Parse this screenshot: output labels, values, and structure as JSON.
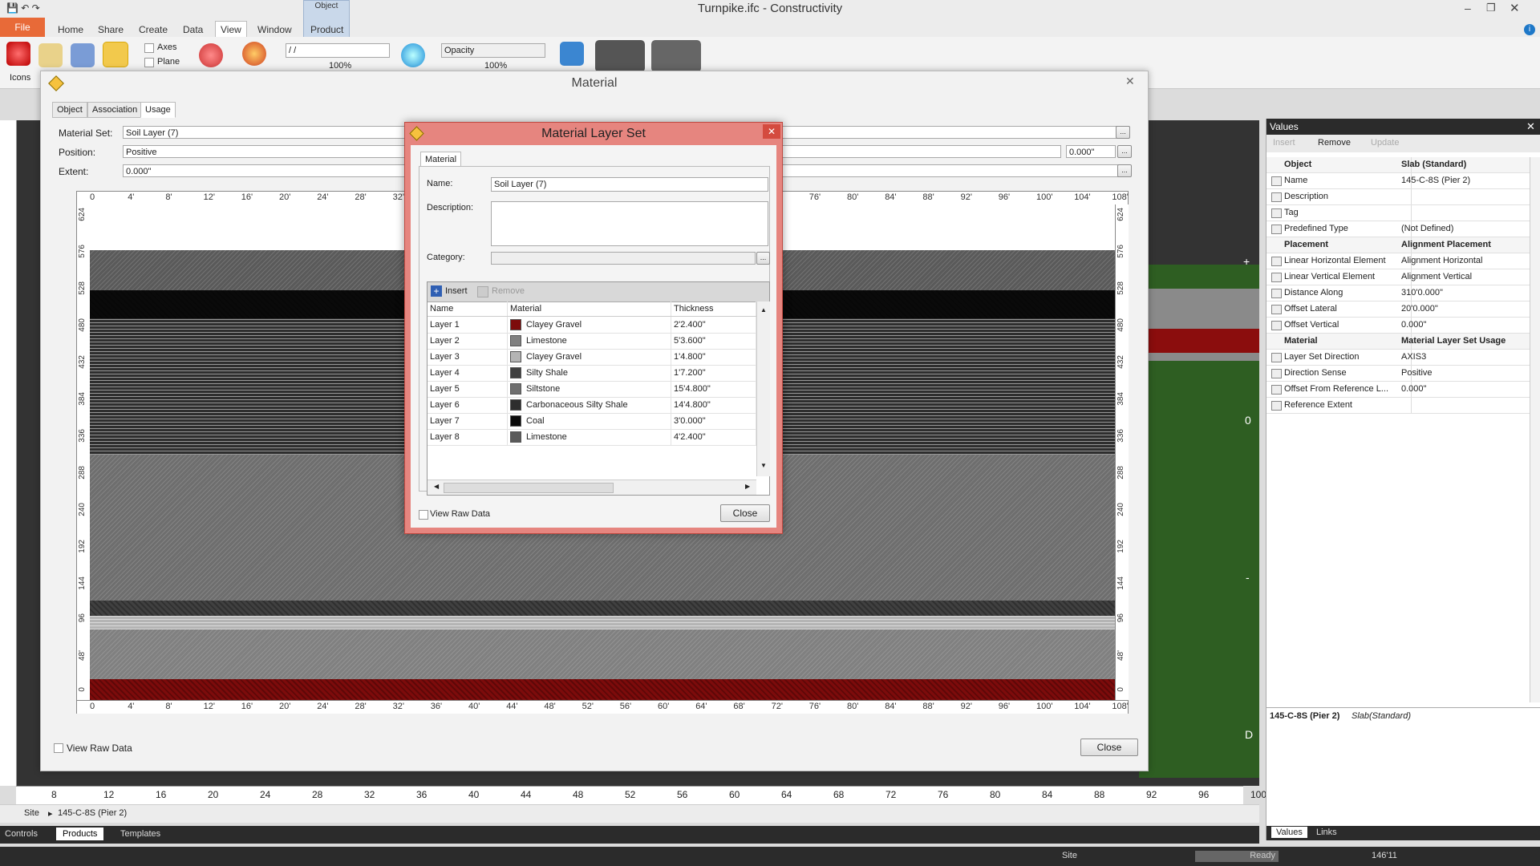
{
  "app": {
    "title": "Turnpike.ifc  -  Constructivity"
  },
  "menu": {
    "file": "File",
    "items": [
      "Home",
      "Share",
      "Create",
      "Data",
      "View",
      "Window",
      "Product"
    ],
    "active": "View",
    "context_tab": "Object"
  },
  "ribbon": {
    "icons_label": "Icons",
    "axes_label": "Axes",
    "plane_label": "Plane",
    "view_select": "/ /",
    "pct1": "100%",
    "opacity_label": "Opacity",
    "pct2": "100%"
  },
  "material_window": {
    "title": "Material",
    "tabs": [
      "Object",
      "Association",
      "Usage"
    ],
    "selected_tab": "Usage",
    "material_set_label": "Material Set:",
    "material_set_value": "Soil Layer (7)",
    "position_label": "Position:",
    "position_value": "Positive",
    "position_offset": "0.000\"",
    "extent_label": "Extent:",
    "extent_value": "0.000\"",
    "view_raw_label": "View Raw Data",
    "close_label": "Close",
    "top_ruler": [
      "0",
      "4'",
      "8'",
      "12'",
      "16'",
      "20'",
      "24'",
      "28'",
      "32'",
      "36'",
      "40'",
      "44'",
      "48'",
      "52'",
      "56'",
      "60'",
      "64'",
      "68'",
      "72'",
      "76'",
      "80'",
      "84'",
      "88'",
      "92'",
      "96'",
      "100'",
      "104'",
      "108'"
    ],
    "side_ruler": [
      "624",
      "576",
      "528",
      "480",
      "432",
      "384",
      "336",
      "288",
      "240",
      "192",
      "144",
      "96",
      "48'",
      "0"
    ]
  },
  "dialog": {
    "title": "Material Layer Set",
    "tab": "Material",
    "name_label": "Name:",
    "name_value": "Soil Layer (7)",
    "description_label": "Description:",
    "category_label": "Category:",
    "insert_label": "Insert",
    "remove_label": "Remove",
    "columns": [
      "Name",
      "Material",
      "Thickness"
    ],
    "rows": [
      {
        "name": "Layer 1",
        "material": "Clayey Gravel",
        "color": "#7d0b0b",
        "thickness": "2'2.400\""
      },
      {
        "name": "Layer 2",
        "material": "Limestone",
        "color": "#808080",
        "thickness": "5'3.600\""
      },
      {
        "name": "Layer 3",
        "material": "Clayey Gravel",
        "color": "#b4b4b4",
        "thickness": "1'4.800\""
      },
      {
        "name": "Layer 4",
        "material": "Silty Shale",
        "color": "#404040",
        "thickness": "1'7.200\""
      },
      {
        "name": "Layer 5",
        "material": "Siltstone",
        "color": "#6e6e6e",
        "thickness": "15'4.800\""
      },
      {
        "name": "Layer 6",
        "material": "Carbonaceous Silty Shale",
        "color": "#2e2e2e",
        "thickness": "14'4.800\""
      },
      {
        "name": "Layer 7",
        "material": "Coal",
        "color": "#0a0a0a",
        "thickness": "3'0.000\""
      },
      {
        "name": "Layer 8",
        "material": "Limestone",
        "color": "#5a5a5a",
        "thickness": "4'2.400\""
      }
    ],
    "view_raw_label": "View Raw Data",
    "close_label": "Close"
  },
  "values_panel": {
    "title": "Values",
    "insert": "Insert",
    "remove": "Remove",
    "update": "Update",
    "rows": [
      {
        "name": "Object",
        "value": "Slab (Standard)",
        "group": true
      },
      {
        "name": "Name",
        "value": "145-C-8S (Pier 2)"
      },
      {
        "name": "Description",
        "value": ""
      },
      {
        "name": "Tag",
        "value": ""
      },
      {
        "name": "Predefined Type",
        "value": "(Not Defined)"
      },
      {
        "name": "Placement",
        "value": "Alignment Placement",
        "group": true
      },
      {
        "name": "Linear Horizontal Element",
        "value": "Alignment Horizontal"
      },
      {
        "name": "Linear Vertical Element",
        "value": "Alignment Vertical"
      },
      {
        "name": "Distance Along",
        "value": "310'0.000\""
      },
      {
        "name": "Offset Lateral",
        "value": "20'0.000\""
      },
      {
        "name": "Offset Vertical",
        "value": "0.000\""
      },
      {
        "name": "Material",
        "value": "Material Layer Set Usage",
        "group": true
      },
      {
        "name": "Layer Set Direction",
        "value": "AXIS3"
      },
      {
        "name": "Direction Sense",
        "value": "Positive"
      },
      {
        "name": "Offset From Reference L...",
        "value": "0.000\""
      },
      {
        "name": "Reference Extent",
        "value": ""
      }
    ],
    "footer_name": "145-C-8S  (Pier 2)",
    "footer_type": "Slab(Standard)",
    "tab_values": "Values",
    "tab_links": "Links"
  },
  "path": {
    "site": "Site",
    "item": "145-C-8S (Pier 2)"
  },
  "bottom_tabs": [
    "Controls",
    "Products",
    "Templates"
  ],
  "status": {
    "site": "Site",
    "ready": "Ready",
    "zoom": "146'11"
  },
  "bottom_ruler": [
    "8",
    "12",
    "16",
    "20",
    "24",
    "28",
    "32",
    "36",
    "40",
    "44",
    "48",
    "52",
    "56",
    "60",
    "64",
    "68",
    "72",
    "76",
    "80",
    "84",
    "88",
    "92",
    "96",
    "100"
  ],
  "viewport_marks": {
    "plus": "+",
    "zero": "0",
    "dash": "-",
    "d": "D"
  }
}
